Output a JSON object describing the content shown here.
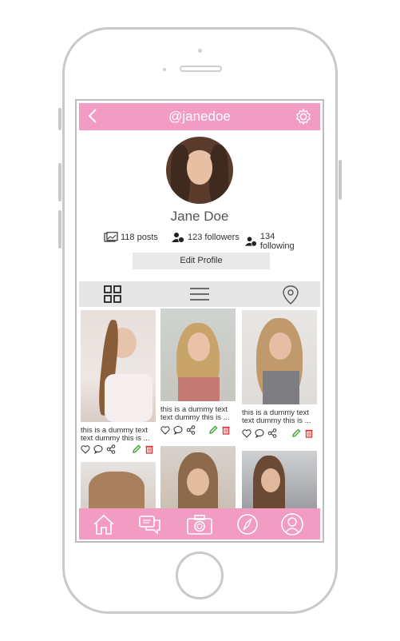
{
  "app": {
    "header_title": "@janedoe",
    "back_label": "<",
    "profile_name": "Jane Doe",
    "stats": {
      "posts": "118 posts",
      "followers": "123 followers",
      "following": "134 following"
    },
    "edit_profile_label": "Edit Profile"
  },
  "posts": [
    {
      "caption_line1": "this is a dummy text",
      "caption_line2": "text dummy this is ..."
    },
    {
      "caption_line1": "this is a dummy text",
      "caption_line2": "text dummy this is ..."
    },
    {
      "caption_line1": "this is a dummy text",
      "caption_line2": "text dummy this is ..."
    }
  ],
  "icons": [
    "back-icon",
    "gear-icon",
    "photos-icon",
    "followers-icon",
    "following-icon",
    "grid-view-icon",
    "list-view-icon",
    "location-icon",
    "heart-icon",
    "comment-icon",
    "share-icon",
    "edit-icon",
    "trash-icon",
    "home-icon",
    "chat-icon",
    "camera-icon",
    "compass-icon",
    "profile-icon"
  ],
  "colors": {
    "accent": "#f39cc3",
    "edit_green": "#3fa535",
    "delete_red": "#e03030",
    "bar_gray": "#e6e6e6"
  }
}
